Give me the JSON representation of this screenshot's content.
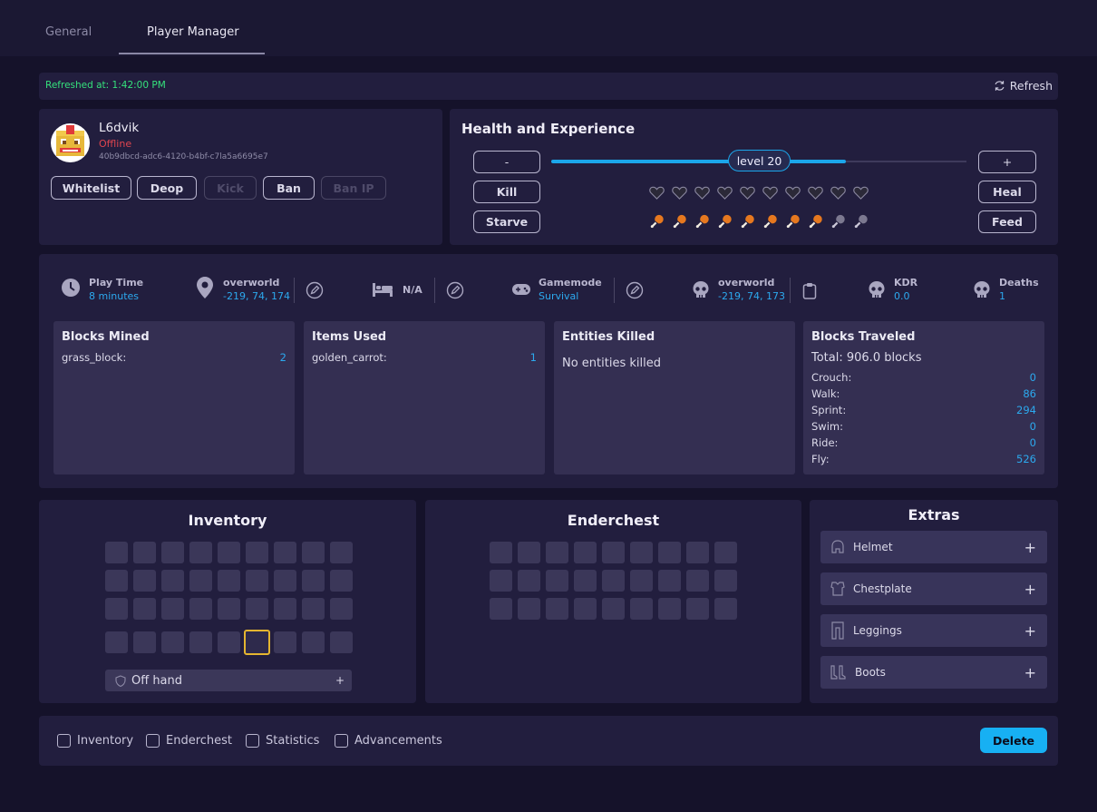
{
  "tabs": [
    {
      "label": "General"
    },
    {
      "label": "Player Manager"
    }
  ],
  "refresh": {
    "status": "Refreshed at: 1:42:00 PM",
    "button": "Refresh"
  },
  "player": {
    "name": "L6dvik",
    "status": "Offline",
    "uuid": "40b9dbcd-adc6-4120-b4bf-c7la5a6695e7",
    "status_color": "#e0454f",
    "actions": [
      {
        "label": "Whitelist",
        "enabled": true
      },
      {
        "label": "Deop",
        "enabled": true
      },
      {
        "label": "Kick",
        "enabled": false
      },
      {
        "label": "Ban",
        "enabled": true
      },
      {
        "label": "Ban IP",
        "enabled": false
      }
    ]
  },
  "health": {
    "title": "Health and Experience",
    "minus": "-",
    "plus": "+",
    "level_label": "level 20",
    "level_fill": 0.71,
    "kill": "Kill",
    "heal": "Heal",
    "starve": "Starve",
    "feed": "Feed",
    "hearts": 10,
    "hunger_full": 8,
    "hunger_total": 10,
    "heart_icon": "heart-icon",
    "food_icon": "drumstick-icon"
  },
  "stats": {
    "play_time": {
      "label": "Play Time",
      "value": "8 minutes"
    },
    "location": {
      "label": "overworld",
      "value": "-219, 74, 174"
    },
    "bed": {
      "label": "N/A"
    },
    "gamemode": {
      "label": "Gamemode",
      "value": "Survival"
    },
    "death_location": {
      "label": "overworld",
      "value": "-219, 74, 173"
    },
    "kdr": {
      "label": "KDR",
      "value": "0.0"
    },
    "deaths": {
      "label": "Deaths",
      "value": "1"
    }
  },
  "cards": {
    "blocks_mined": {
      "title": "Blocks Mined",
      "rows": [
        {
          "k": "grass_block:",
          "v": "2"
        }
      ]
    },
    "items_used": {
      "title": "Items Used",
      "rows": [
        {
          "k": "golden_carrot:",
          "v": "1"
        }
      ]
    },
    "entities_killed": {
      "title": "Entities Killed",
      "empty": "No entities killed"
    },
    "blocks_traveled": {
      "title": "Blocks Traveled",
      "total": "Total: 906.0 blocks",
      "rows": [
        {
          "k": "Crouch:",
          "v": "0"
        },
        {
          "k": "Walk:",
          "v": "86"
        },
        {
          "k": "Sprint:",
          "v": "294"
        },
        {
          "k": "Swim:",
          "v": "0"
        },
        {
          "k": "Ride:",
          "v": "0"
        },
        {
          "k": "Fly:",
          "v": "526"
        }
      ]
    }
  },
  "inventory": {
    "title": "Inventory",
    "offhand": "Off hand",
    "offhand_plus": "+",
    "selected_hotbar_slot": 6
  },
  "enderchest": {
    "title": "Enderchest"
  },
  "extras": {
    "title": "Extras",
    "items": [
      {
        "label": "Helmet",
        "plus": "+",
        "icon": "helmet-icon"
      },
      {
        "label": "Chestplate",
        "plus": "+",
        "icon": "chestplate-icon"
      },
      {
        "label": "Leggings",
        "plus": "+",
        "icon": "leggings-icon"
      },
      {
        "label": "Boots",
        "plus": "+",
        "icon": "boots-icon"
      }
    ]
  },
  "footer": {
    "checkboxes": [
      {
        "label": "Inventory"
      },
      {
        "label": "Enderchest"
      },
      {
        "label": "Statistics"
      },
      {
        "label": "Advancements"
      }
    ],
    "delete": "Delete"
  },
  "colors": {
    "accent": "#1ba6ea",
    "online_green": "#35e27c",
    "offline_red": "#e0454f",
    "selected_slot": "#e4b530"
  }
}
